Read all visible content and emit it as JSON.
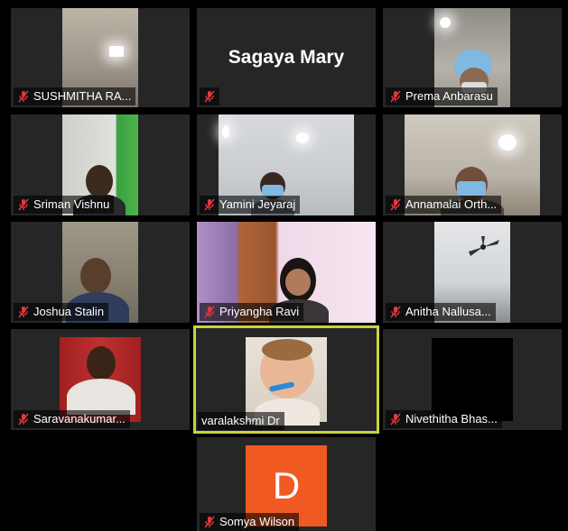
{
  "participants": [
    {
      "name": "SUSHMITHA RA...",
      "muted": true
    },
    {
      "name": "",
      "display_name": "Sagaya Mary",
      "muted": true
    },
    {
      "name": "Prema Anbarasu",
      "muted": true
    },
    {
      "name": "Sriman Vishnu",
      "muted": true
    },
    {
      "name": "Yamini Jeyaraj",
      "muted": true
    },
    {
      "name": "Annamalai Orth...",
      "muted": true
    },
    {
      "name": "Joshua Stalin",
      "muted": true
    },
    {
      "name": "Priyangha Ravi",
      "muted": true
    },
    {
      "name": "Anitha Nallusa...",
      "muted": true
    },
    {
      "name": "Saravanakumar...",
      "muted": true
    },
    {
      "name": "varalakshmi Dr",
      "muted": false,
      "active_speaker": true
    },
    {
      "name": "Nivethitha Bhas...",
      "muted": true
    },
    {
      "name": "Somya Wilson",
      "muted": true,
      "avatar_letter": "D"
    }
  ],
  "colors": {
    "active_border": "#c8d33f",
    "tile_bg": "#262626",
    "muted_icon": "#e0393e",
    "avatar_bg": "#f05a22"
  }
}
